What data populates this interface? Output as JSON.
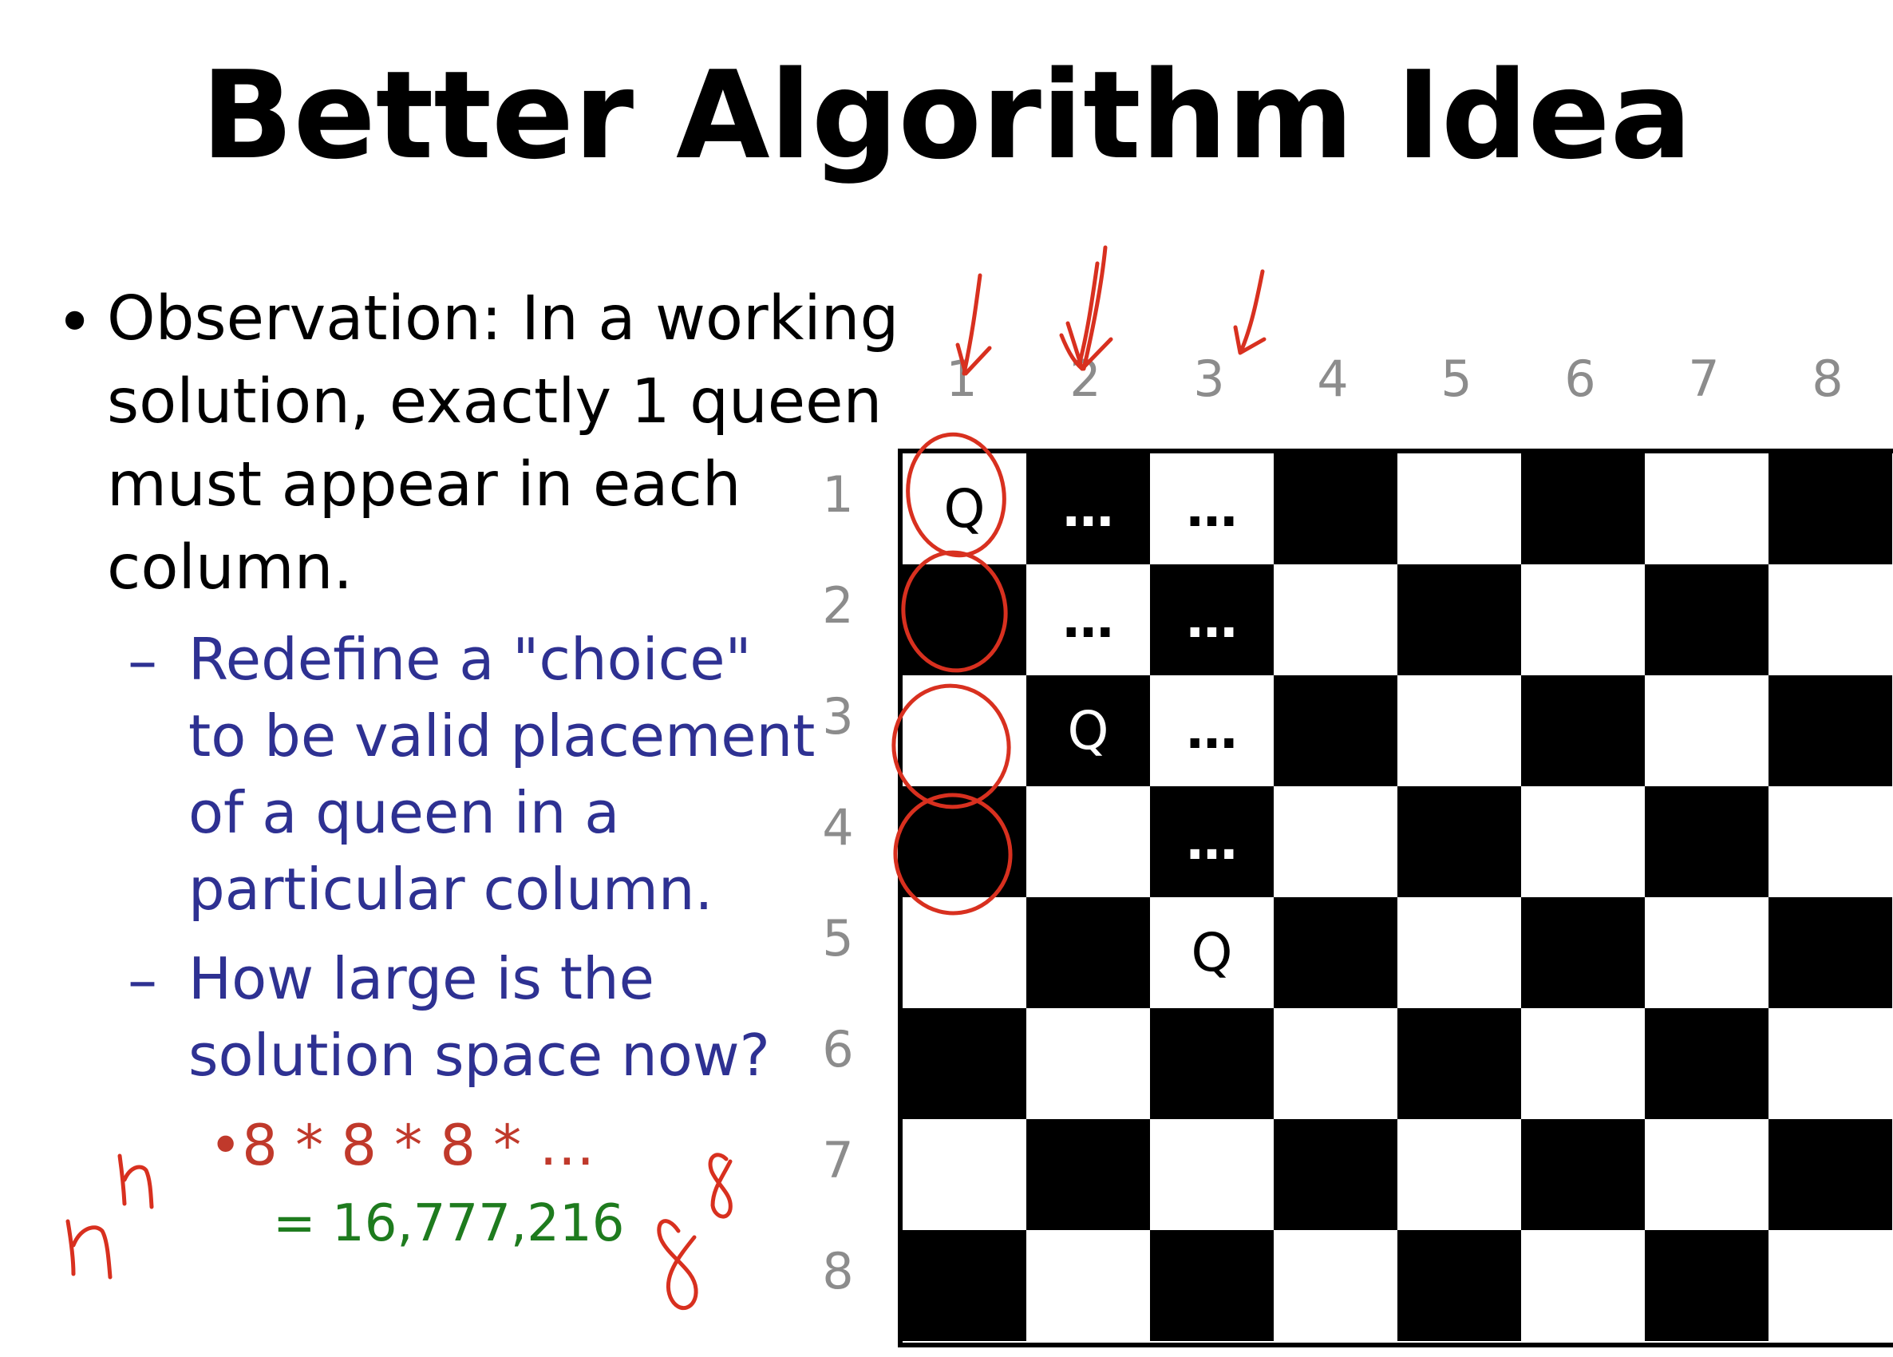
{
  "slide": {
    "title": "Better Algorithm Idea",
    "bullet_symbol": "•",
    "observation_lines": [
      "Observation: In a working",
      "solution, exactly 1 queen",
      "must appear in each",
      "column."
    ],
    "dash_symbol": "–",
    "sub_bullets": [
      {
        "lines": [
          "Redefine a \"choice\"",
          "to be valid placement",
          "of a queen in a",
          "particular column."
        ]
      },
      {
        "lines": [
          "How large is the",
          "solution space now?"
        ]
      }
    ],
    "formula": "•8 * 8 * 8 * …",
    "result": "= 16,777,216"
  },
  "board": {
    "column_labels": [
      "1",
      "2",
      "3",
      "4",
      "5",
      "6",
      "7",
      "8"
    ],
    "row_labels": [
      "1",
      "2",
      "3",
      "4",
      "5",
      "6",
      "7",
      "8"
    ],
    "marks": [
      [
        "Q",
        "…",
        "…",
        "",
        "",
        "",
        "",
        ""
      ],
      [
        "",
        "…",
        "…",
        "",
        "",
        "",
        "",
        ""
      ],
      [
        "",
        "Q",
        "…",
        "",
        "",
        "",
        "",
        ""
      ],
      [
        "",
        "",
        "…",
        "",
        "",
        "",
        "",
        ""
      ],
      [
        "",
        "",
        "Q",
        "",
        "",
        "",
        "",
        ""
      ],
      [
        "",
        "",
        "",
        "",
        "",
        "",
        "",
        ""
      ],
      [
        "",
        "",
        "",
        "",
        "",
        "",
        "",
        ""
      ],
      [
        "",
        "",
        "",
        "",
        "",
        "",
        "",
        ""
      ]
    ],
    "queen_symbol": "Q",
    "light_color": "#ffffff",
    "dark_color": "#000000"
  },
  "annotations": {
    "ink_color": "#d8301f",
    "handwritten": [
      "n^n",
      "8^8"
    ],
    "icons": [
      "arrow-down-icon",
      "arrow-down-icon",
      "arrow-down-icon",
      "circle-icon",
      "circle-icon",
      "circle-icon",
      "circle-icon"
    ]
  },
  "colors": {
    "title": "#000000",
    "main_text": "#000000",
    "sub_text": "#2e3192",
    "formula": "#c0392b",
    "result": "#1e7b1e",
    "labels": "#8c8c8c"
  }
}
